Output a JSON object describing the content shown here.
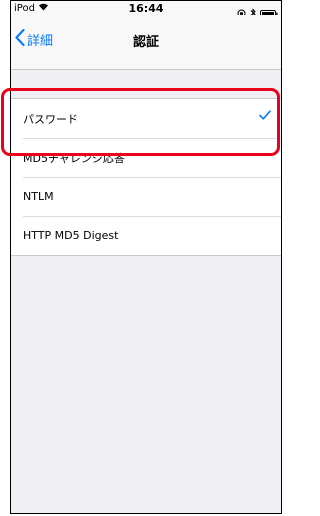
{
  "status": {
    "device": "iPod",
    "time": "16:44"
  },
  "nav": {
    "back_label": "詳細",
    "title": "認証"
  },
  "options": [
    {
      "label": "パスワード",
      "selected": true
    },
    {
      "label": "MD5チャレンジ応答",
      "selected": false
    },
    {
      "label": "NTLM",
      "selected": false
    },
    {
      "label": "HTTP MD5 Digest",
      "selected": false
    }
  ],
  "colors": {
    "accent": "#0a7aff",
    "highlight": "#e8001c"
  }
}
